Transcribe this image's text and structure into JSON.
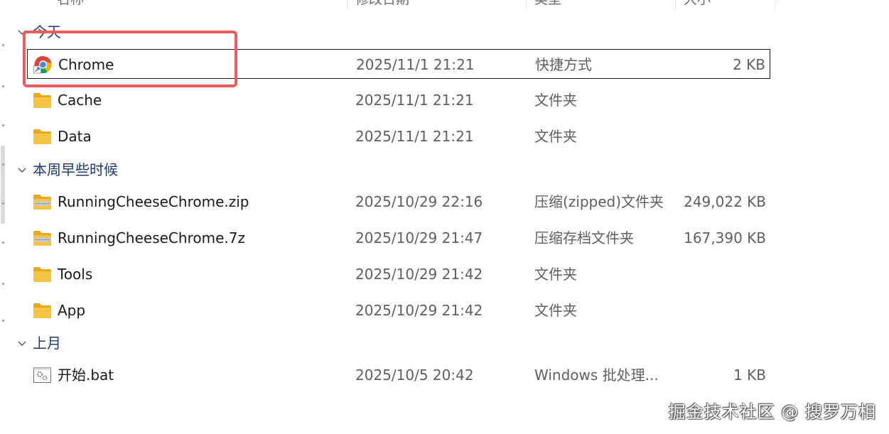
{
  "columns": {
    "name": "名称",
    "date": "修改日期",
    "type": "类型",
    "size": "大小"
  },
  "groups": [
    {
      "title": "今天",
      "files": [
        {
          "name": "Chrome",
          "date": "2025/11/1 21:21",
          "type": "快捷方式",
          "size": "2 KB",
          "icon": "chrome-shortcut-icon"
        },
        {
          "name": "Cache",
          "date": "2025/11/1 21:21",
          "type": "文件夹",
          "size": "",
          "icon": "folder-icon"
        },
        {
          "name": "Data",
          "date": "2025/11/1 21:21",
          "type": "文件夹",
          "size": "",
          "icon": "folder-icon"
        }
      ]
    },
    {
      "title": "本周早些时候",
      "files": [
        {
          "name": "RunningCheeseChrome.zip",
          "date": "2025/10/29 22:16",
          "type": "压缩(zipped)文件夹",
          "size": "249,022 KB",
          "icon": "zip-folder-icon"
        },
        {
          "name": "RunningCheeseChrome.7z",
          "date": "2025/10/29 21:47",
          "type": "压缩存档文件夹",
          "size": "167,390 KB",
          "icon": "zip-folder-icon"
        },
        {
          "name": "Tools",
          "date": "2025/10/29 21:42",
          "type": "文件夹",
          "size": "",
          "icon": "folder-icon"
        },
        {
          "name": "App",
          "date": "2025/10/29 21:42",
          "type": "文件夹",
          "size": "",
          "icon": "folder-icon"
        }
      ]
    },
    {
      "title": "上月",
      "files": [
        {
          "name": "开始.bat",
          "date": "2025/10/5 20:42",
          "type": "Windows 批处理...",
          "size": "1 KB",
          "icon": "batch-file-icon"
        }
      ]
    }
  ],
  "watermark": "掘金技术社区 @ 搜罗万相",
  "colors": {
    "highlight": "#ef5a5a",
    "folder": "#f6c443",
    "group_title": "#1e3a70"
  }
}
